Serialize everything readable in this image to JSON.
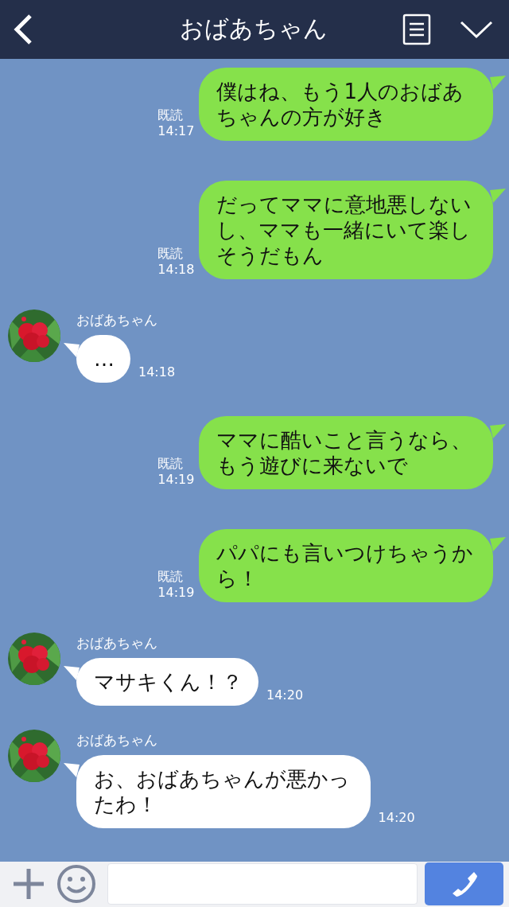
{
  "header": {
    "title": "おばあちゃん"
  },
  "messages": [
    {
      "kind": "sent",
      "text": "僕はね、もう1人のおばあちゃんの方が好き",
      "read": "既読",
      "time": "14:17"
    },
    {
      "kind": "sent",
      "text": "だってママに意地悪しないし、ママも一緒にいて楽しそうだもん",
      "read": "既読",
      "time": "14:18"
    },
    {
      "kind": "received",
      "sender": "おばあちゃん",
      "text": "…",
      "time": "14:18"
    },
    {
      "kind": "sent",
      "text": "ママに酷いこと言うなら、もう遊びに来ないで",
      "read": "既読",
      "time": "14:19"
    },
    {
      "kind": "sent",
      "text": "パパにも言いつけちゃうから！",
      "read": "既読",
      "time": "14:19"
    },
    {
      "kind": "received",
      "sender": "おばあちゃん",
      "text": "マサキくん！？",
      "time": "14:20"
    },
    {
      "kind": "received",
      "sender": "おばあちゃん",
      "text": "お、おばあちゃんが悪かったわ！",
      "time": "14:20"
    }
  ]
}
